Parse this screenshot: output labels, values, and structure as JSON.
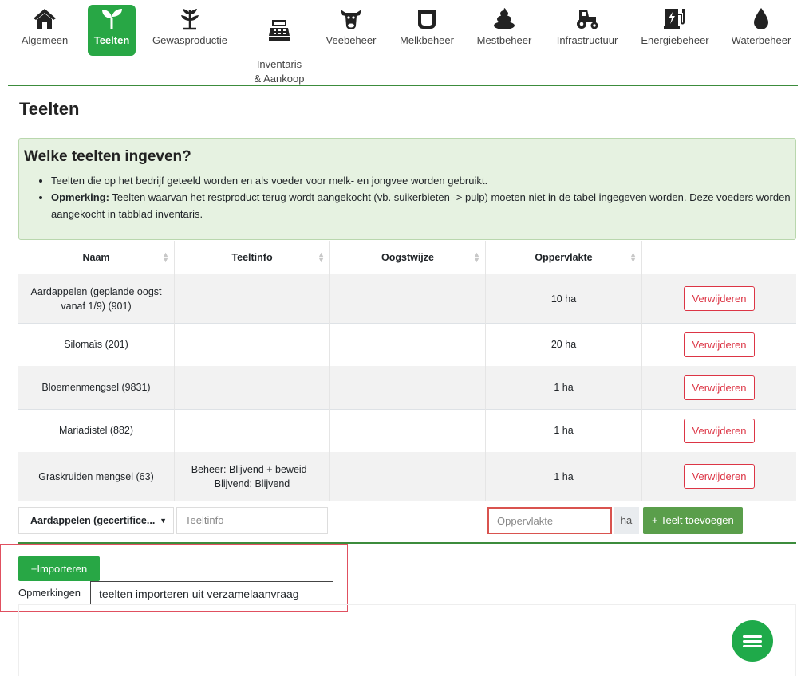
{
  "nav": {
    "items": [
      {
        "label": "Algemeen",
        "icon": "home-icon"
      },
      {
        "label": "Teelten",
        "icon": "sprout-icon",
        "active": true
      },
      {
        "label": "Gewasproductie",
        "icon": "plant-icon"
      },
      {
        "label": "Inventaris\n& Aankoop",
        "icon": "cash-register-icon"
      },
      {
        "label": "Veebeheer",
        "icon": "cow-icon"
      },
      {
        "label": "Melkbeheer",
        "icon": "bucket-icon"
      },
      {
        "label": "Mestbeheer",
        "icon": "manure-icon"
      },
      {
        "label": "Infrastructuur",
        "icon": "tractor-icon"
      },
      {
        "label": "Energiebeheer",
        "icon": "charging-station-icon"
      },
      {
        "label": "Waterbeheer",
        "icon": "water-drop-icon"
      }
    ]
  },
  "page": {
    "title": "Teelten"
  },
  "info": {
    "heading": "Welke teelten ingeven?",
    "bullet1": "Teelten die op het bedrijf geteeld worden en als voeder voor melk- en jongvee worden gebruikt.",
    "bullet2_strong": "Opmerking:",
    "bullet2_text": " Teelten waarvan het restproduct terug wordt aangekocht (vb. suikerbieten -> pulp) moeten niet in de tabel ingegeven worden. Deze voeders worden aangekocht in tabblad inventaris."
  },
  "table": {
    "columns": [
      "Naam",
      "Teeltinfo",
      "Oogstwijze",
      "Oppervlakte",
      ""
    ],
    "rows": [
      {
        "naam": "Aardappelen (geplande oogst vanaf 1/9) (901)",
        "teeltinfo": "",
        "oogstwijze": "",
        "oppervlakte": "10 ha",
        "action": "Verwijderen"
      },
      {
        "naam": "Silomaïs (201)",
        "teeltinfo": "",
        "oogstwijze": "",
        "oppervlakte": "20 ha",
        "action": "Verwijderen"
      },
      {
        "naam": "Bloemenmengsel (9831)",
        "teeltinfo": "",
        "oogstwijze": "",
        "oppervlakte": "1 ha",
        "action": "Verwijderen"
      },
      {
        "naam": "Mariadistel (882)",
        "teeltinfo": "",
        "oogstwijze": "",
        "oppervlakte": "1 ha",
        "action": "Verwijderen"
      },
      {
        "naam": "Graskruiden mengsel (63)",
        "teeltinfo": "Beheer: Blijvend + beweid - Blijvend: Blijvend",
        "oogstwijze": "",
        "oppervlakte": "1 ha",
        "action": "Verwijderen"
      }
    ]
  },
  "form": {
    "crop_select": "Aardappelen (gecertifice...",
    "teeltinfo_placeholder": "Teeltinfo",
    "area_placeholder": "Oppervlakte",
    "unit": "ha",
    "add_button": "+ Teelt toevoegen"
  },
  "import": {
    "button": "+Importeren",
    "remarks_label": "Opmerkingen",
    "tooltip": "teelten importeren uit verzamelaanvraag"
  },
  "colors": {
    "accent": "#28a745",
    "danger": "#dc3545",
    "alert_bg": "#e6f2e1"
  }
}
